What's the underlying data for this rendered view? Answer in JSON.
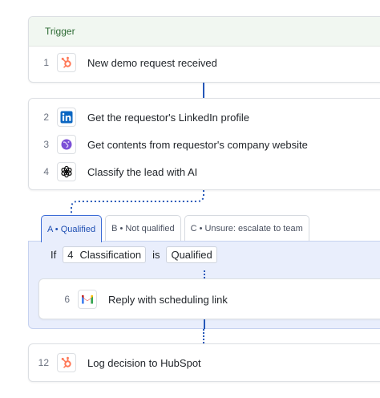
{
  "trigger": {
    "header": "Trigger",
    "step": {
      "num": "1",
      "label": "New demo request received",
      "icon": "hubspot-icon"
    }
  },
  "steps": [
    {
      "num": "2",
      "label": "Get the requestor's LinkedIn profile",
      "icon": "linkedin-icon"
    },
    {
      "num": "3",
      "label": "Get contents from requestor's company website",
      "icon": "web-icon"
    },
    {
      "num": "4",
      "label": "Classify the lead with AI",
      "icon": "openai-icon"
    }
  ],
  "branch_tabs": [
    {
      "label": "A • Qualified",
      "active": true
    },
    {
      "label": "B • Not qualified",
      "active": false
    },
    {
      "label": "C • Unsure: escalate to team",
      "active": false
    }
  ],
  "condition": {
    "if_word": "If",
    "step_ref_num": "4",
    "step_ref_label": "Classification",
    "is_word": "is",
    "value": "Qualified"
  },
  "branch_step": {
    "num": "6",
    "label": "Reply with scheduling link",
    "icon": "gmail-icon"
  },
  "final_step": {
    "num": "12",
    "label": "Log decision to HubSpot",
    "icon": "hubspot-icon"
  },
  "colors": {
    "connector": "#2557b8",
    "hubspot": "#ff7a59",
    "linkedin": "#0a66c2",
    "web": "#7b4fd6",
    "trigger_bg": "#f1f7f1",
    "branch_bg": "#e9eefc"
  }
}
